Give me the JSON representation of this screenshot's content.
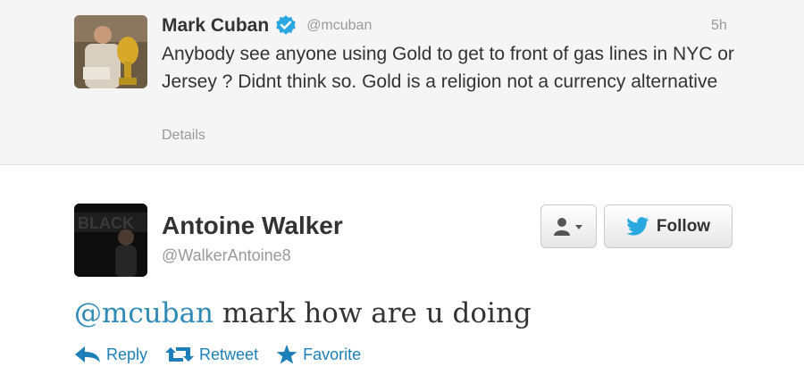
{
  "reply_to": {
    "name": "Mark Cuban",
    "handle": "@mcuban",
    "time": "5h",
    "text": "Anybody see anyone using Gold to get to front of gas lines in NYC or Jersey ? Didnt think so. Gold is a religion not a currency alternative",
    "details_label": "Details"
  },
  "tweet": {
    "name": "Antoine Walker",
    "handle": "@WalkerAntoine8",
    "mention": "@mcuban",
    "text": " mark how are u doing"
  },
  "buttons": {
    "follow_label": "Follow"
  },
  "actions": {
    "reply": "Reply",
    "retweet": "Retweet",
    "favorite": "Favorite"
  },
  "colors": {
    "link": "#1c7fb9",
    "verified": "#2ba7e2",
    "twitter_bird": "#2aa9e0",
    "top_background": "#f5f5f5"
  }
}
